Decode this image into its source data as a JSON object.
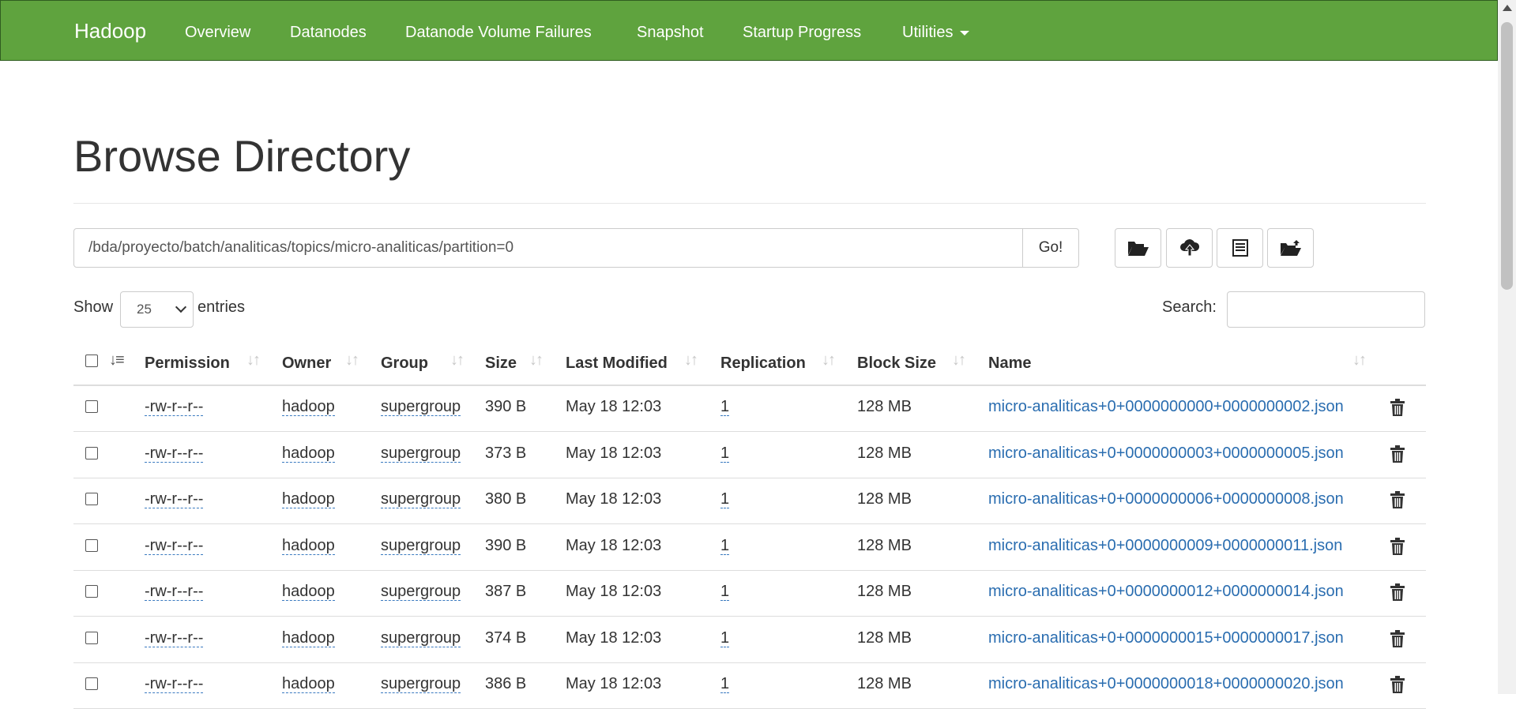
{
  "navbar": {
    "brand": "Hadoop",
    "items": [
      "Overview",
      "Datanodes",
      "Datanode Volume Failures",
      "Snapshot",
      "Startup Progress",
      "Utilities"
    ]
  },
  "page": {
    "title": "Browse Directory"
  },
  "path_bar": {
    "value": "/bda/proyecto/batch/analiticas/topics/micro-analiticas/partition=0",
    "go_label": "Go!",
    "tools": [
      "folder-open-icon",
      "cloud-upload-icon",
      "list-icon",
      "folder-move-icon"
    ]
  },
  "length": {
    "show_label": "Show",
    "selected": "25",
    "entries_label": "entries"
  },
  "search": {
    "label": "Search:",
    "value": ""
  },
  "table": {
    "columns": [
      "Permission",
      "Owner",
      "Group",
      "Size",
      "Last Modified",
      "Replication",
      "Block Size",
      "Name"
    ],
    "rows": [
      {
        "permission": "-rw-r--r--",
        "owner": "hadoop",
        "group": "supergroup",
        "size": "390 B",
        "modified": "May 18 12:03",
        "replication": "1",
        "block_size": "128 MB",
        "name": "micro-analiticas+0+0000000000+0000000002.json"
      },
      {
        "permission": "-rw-r--r--",
        "owner": "hadoop",
        "group": "supergroup",
        "size": "373 B",
        "modified": "May 18 12:03",
        "replication": "1",
        "block_size": "128 MB",
        "name": "micro-analiticas+0+0000000003+0000000005.json"
      },
      {
        "permission": "-rw-r--r--",
        "owner": "hadoop",
        "group": "supergroup",
        "size": "380 B",
        "modified": "May 18 12:03",
        "replication": "1",
        "block_size": "128 MB",
        "name": "micro-analiticas+0+0000000006+0000000008.json"
      },
      {
        "permission": "-rw-r--r--",
        "owner": "hadoop",
        "group": "supergroup",
        "size": "390 B",
        "modified": "May 18 12:03",
        "replication": "1",
        "block_size": "128 MB",
        "name": "micro-analiticas+0+0000000009+0000000011.json"
      },
      {
        "permission": "-rw-r--r--",
        "owner": "hadoop",
        "group": "supergroup",
        "size": "387 B",
        "modified": "May 18 12:03",
        "replication": "1",
        "block_size": "128 MB",
        "name": "micro-analiticas+0+0000000012+0000000014.json"
      },
      {
        "permission": "-rw-r--r--",
        "owner": "hadoop",
        "group": "supergroup",
        "size": "374 B",
        "modified": "May 18 12:03",
        "replication": "1",
        "block_size": "128 MB",
        "name": "micro-analiticas+0+0000000015+0000000017.json"
      },
      {
        "permission": "-rw-r--r--",
        "owner": "hadoop",
        "group": "supergroup",
        "size": "386 B",
        "modified": "May 18 12:03",
        "replication": "1",
        "block_size": "128 MB",
        "name": "micro-analiticas+0+0000000018+0000000020.json"
      }
    ]
  },
  "colors": {
    "navbar": "#5fa33e",
    "link": "#2a6db0"
  }
}
